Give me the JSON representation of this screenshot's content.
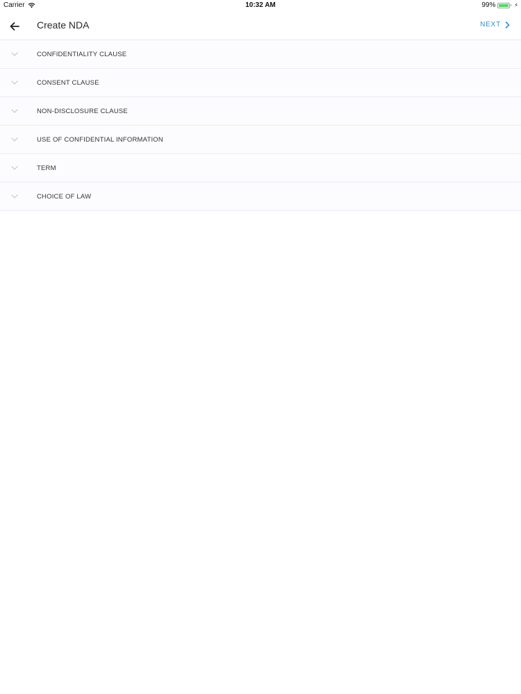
{
  "status_bar": {
    "carrier": "Carrier",
    "time": "10:32 AM",
    "battery_percent": "99%",
    "battery_level": 0.99,
    "icons": [
      "wifi-icon",
      "battery-icon",
      "charging-bolt-icon"
    ]
  },
  "header": {
    "title": "Create NDA",
    "next_label": "NEXT",
    "icons": [
      "arrow-left-icon",
      "chevron-right-icon"
    ],
    "accent_color": "#2f8fd6"
  },
  "sections": [
    {
      "label": "CONFIDENTIALITY CLAUSE"
    },
    {
      "label": "CONSENT CLAUSE"
    },
    {
      "label": "NON-DISCLOSURE CLAUSE"
    },
    {
      "label": "USE OF CONFIDENTIAL INFORMATION"
    },
    {
      "label": "TERM"
    },
    {
      "label": "CHOICE OF LAW"
    }
  ],
  "section_icon": "chevron-down-icon"
}
